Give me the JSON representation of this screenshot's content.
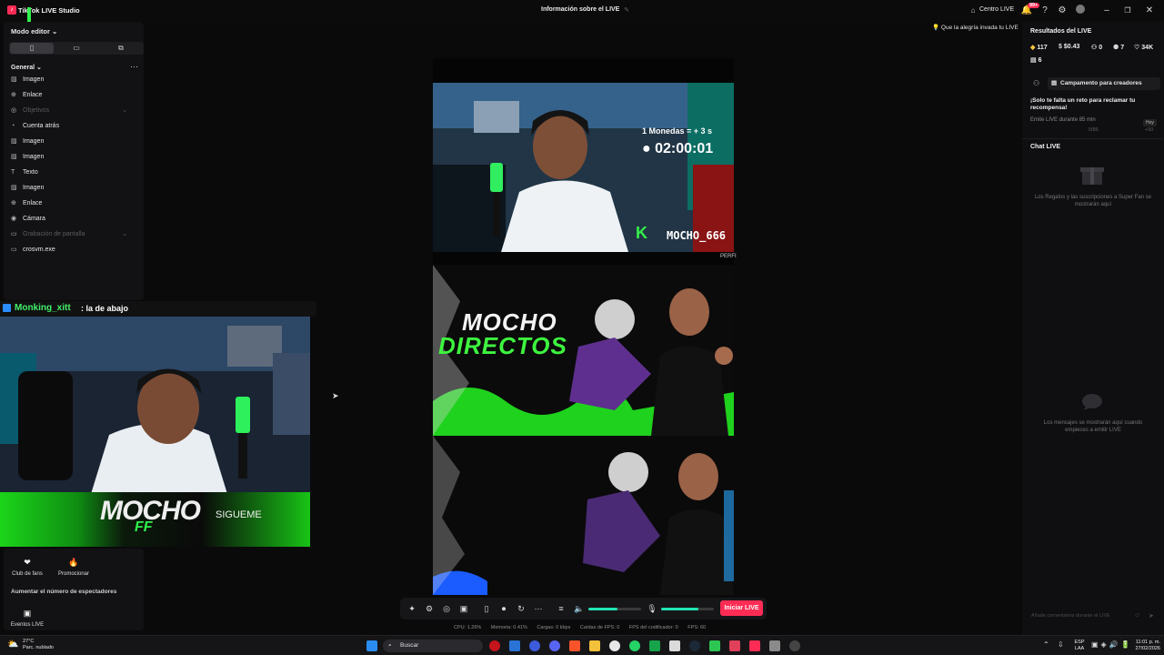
{
  "titlebar": {
    "app_title": "TikTok LIVE Studio",
    "center_title": "Información sobre el LIVE",
    "live_center": "Centro LIVE",
    "notif_badge": "99+"
  },
  "left_panel": {
    "mode_label": "Modo editor",
    "general_label": "General",
    "sources": [
      {
        "label": "Imagen",
        "icon": "image-icon",
        "dim": false
      },
      {
        "label": "Enlace",
        "icon": "link-icon",
        "dim": false
      },
      {
        "label": "Objetivos",
        "icon": "goal-icon",
        "dim": true
      },
      {
        "label": "Cuenta atrás",
        "icon": "timer-icon",
        "dim": false
      },
      {
        "label": "Imagen",
        "icon": "image-icon",
        "dim": false
      },
      {
        "label": "Imagen",
        "icon": "image-icon",
        "dim": false
      },
      {
        "label": "Texto",
        "icon": "text-icon",
        "dim": false
      },
      {
        "label": "Imagen",
        "icon": "image-icon",
        "dim": false
      },
      {
        "label": "Enlace",
        "icon": "link-icon",
        "dim": false
      },
      {
        "label": "Cámara",
        "icon": "camera-icon",
        "dim": false
      },
      {
        "label": "Grabación de pantalla",
        "icon": "screen-record-icon",
        "dim": true
      },
      {
        "label": "crosvm.exe",
        "icon": "window-icon",
        "dim": false
      }
    ]
  },
  "left_overlay": {
    "chat_user": "Monking_xitt",
    "chat_message": ": la de abajo",
    "banner_title": "MOCHO",
    "banner_sub": "FF",
    "banner_follow": "SIGUEME"
  },
  "left_bottom": {
    "club_label": "Club de fans",
    "promote_label": "Promocionar",
    "section_label": "Aumentar el número de espectadores",
    "events_label": "Eventos LIVE"
  },
  "canvas": {
    "coins_text": "1 Monedas = + 3 s",
    "timer": "02:00:01",
    "tag": "MOCHO_666",
    "perf_label": "PERFI",
    "banner_line1": "MOCHO",
    "banner_line2": "DIRECTOS"
  },
  "tip": {
    "text": "Que la alegría invada tu LIVE"
  },
  "controls": {
    "start_live": "Iniciar LIVE",
    "volume_level": 0.55,
    "mic_level": 0.7
  },
  "stats": {
    "cpu": "CPU: 1.26%",
    "memory": "Memoria: 0.41%",
    "upload": "Cargas: 0 kbps",
    "dropped": "Caídas de FPS: 0",
    "encoder": "FPS del codificador: 0",
    "fps": "FPS: 60"
  },
  "right_panel": {
    "results_title": "Resultados del LIVE",
    "metrics": [
      "117",
      "$0.43",
      "0",
      "7",
      "34K",
      "6"
    ],
    "campaign_button": "Campamento para creadores",
    "challenge_title": "¡Solo te falta un reto para reclamar tu recompensa!",
    "challenge_task": "Emite LIVE durante 85 min",
    "challenge_day": "Hoy",
    "challenge_progress": "0/85",
    "challenge_reward": "+50",
    "chat_title": "Chat LIVE",
    "gifts_empty": "Los Regalos y las suscripciones a Super Fan se mostrarán aquí",
    "messages_empty": "Los mensajes se mostrarán aquí cuando empieces a emitir LIVE",
    "chat_placeholder": "Añade comentarios durante el LIVE"
  },
  "taskbar": {
    "temp": "27°C",
    "weather": "Parc. nublado",
    "search": "Buscar",
    "lang1": "ESP",
    "lang2": "LAA",
    "time": "11:01 p. m.",
    "date": "27/02/2026"
  },
  "colors": {
    "accent": "#fe2c55",
    "green": "#2ff24a",
    "teal": "#20e3b2"
  }
}
